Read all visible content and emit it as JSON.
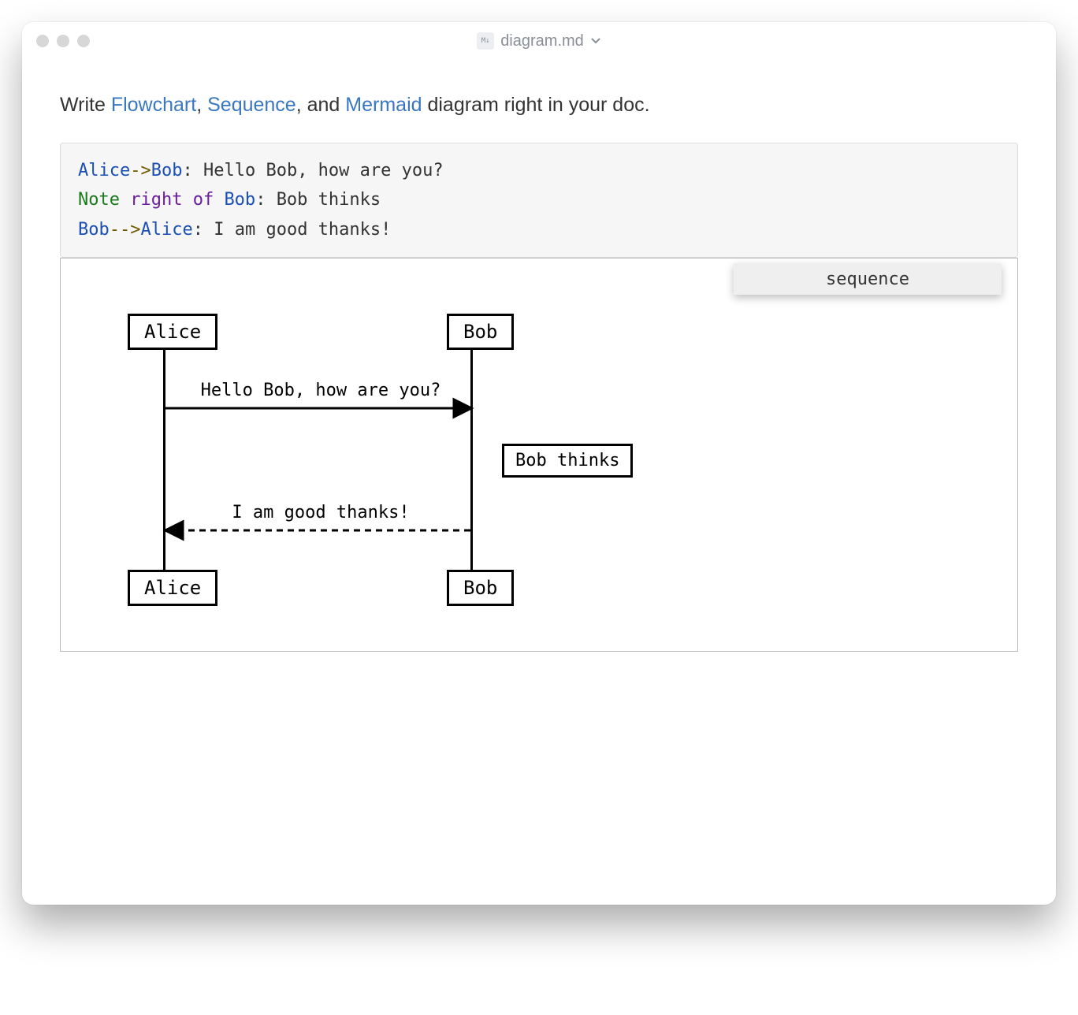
{
  "window": {
    "filename": "diagram.md",
    "badge_glyph": "M↓"
  },
  "intro": {
    "pre": "Write ",
    "link_flowchart": "Flowchart",
    "sep1": ", ",
    "link_sequence": "Sequence",
    "sep2": ", and ",
    "link_mermaid": "Mermaid",
    "post": " diagram right in your doc."
  },
  "code": {
    "line1": {
      "actor1": "Alice",
      "arrow": "->",
      "actor2": "Bob",
      "colon": ": ",
      "text": "Hello Bob, how are you?"
    },
    "line2": {
      "note": "Note",
      "right_of": " right of ",
      "actor": "Bob",
      "colon": ": ",
      "text": "Bob thinks"
    },
    "line3": {
      "actor1": "Bob",
      "arrow": "-->",
      "actor2": "Alice",
      "colon": ": ",
      "text": "I am good thanks!"
    }
  },
  "diagram": {
    "type_label": "sequence",
    "actors": {
      "a": "Alice",
      "b": "Bob"
    },
    "msg1": "Hello Bob, how are you?",
    "note": "Bob thinks",
    "msg2": "I am good thanks!"
  }
}
